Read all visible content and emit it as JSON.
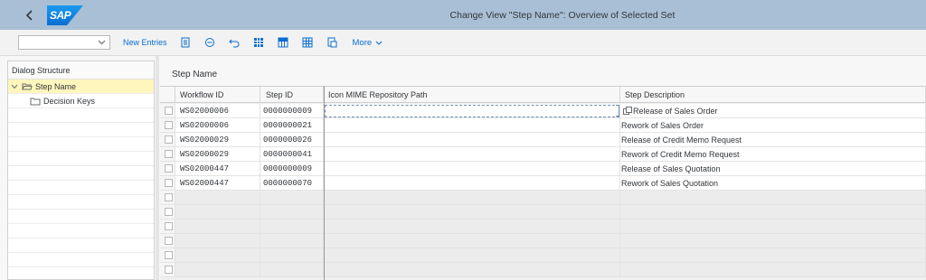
{
  "shell": {
    "title": "Change View \"Step Name\": Overview of Selected Set",
    "logo_text": "SAP",
    "colors": {
      "bar": "#a9bfd6",
      "logo": "#0a6ed1"
    }
  },
  "toolbar": {
    "command_field_value": "",
    "new_entries_label": "New Entries",
    "more_label": "More",
    "icons": [
      "details-icon",
      "delete-icon",
      "undo-icon",
      "select-all-icon",
      "select-block-icon",
      "deselect-all-icon",
      "print-icon"
    ]
  },
  "dialog_structure": {
    "header": "Dialog Structure",
    "items": [
      {
        "label": "Step Name",
        "selected": true,
        "expanded": true
      },
      {
        "label": "Decision Keys",
        "selected": false
      }
    ]
  },
  "section": {
    "title": "Step Name"
  },
  "table": {
    "columns": [
      "Workflow ID",
      "Step ID",
      "Icon MIME Repository Path",
      "Step Description"
    ],
    "rows": [
      {
        "workflow_id": "WS02000006",
        "step_id": "0000000009",
        "icon_path": "",
        "description": "Release of Sales Order"
      },
      {
        "workflow_id": "WS02000006",
        "step_id": "0000000021",
        "icon_path": "",
        "description": "Rework of Sales Order"
      },
      {
        "workflow_id": "WS02000029",
        "step_id": "0000000026",
        "icon_path": "",
        "description": "Release of Credit Memo Request"
      },
      {
        "workflow_id": "WS02000029",
        "step_id": "0000000041",
        "icon_path": "",
        "description": "Rework of Credit Memo Request"
      },
      {
        "workflow_id": "WS02000447",
        "step_id": "0000000009",
        "icon_path": "",
        "description": "Release of Sales Quotation"
      },
      {
        "workflow_id": "WS02000447",
        "step_id": "0000000070",
        "icon_path": "",
        "description": "Rework of Sales Quotation"
      }
    ]
  }
}
